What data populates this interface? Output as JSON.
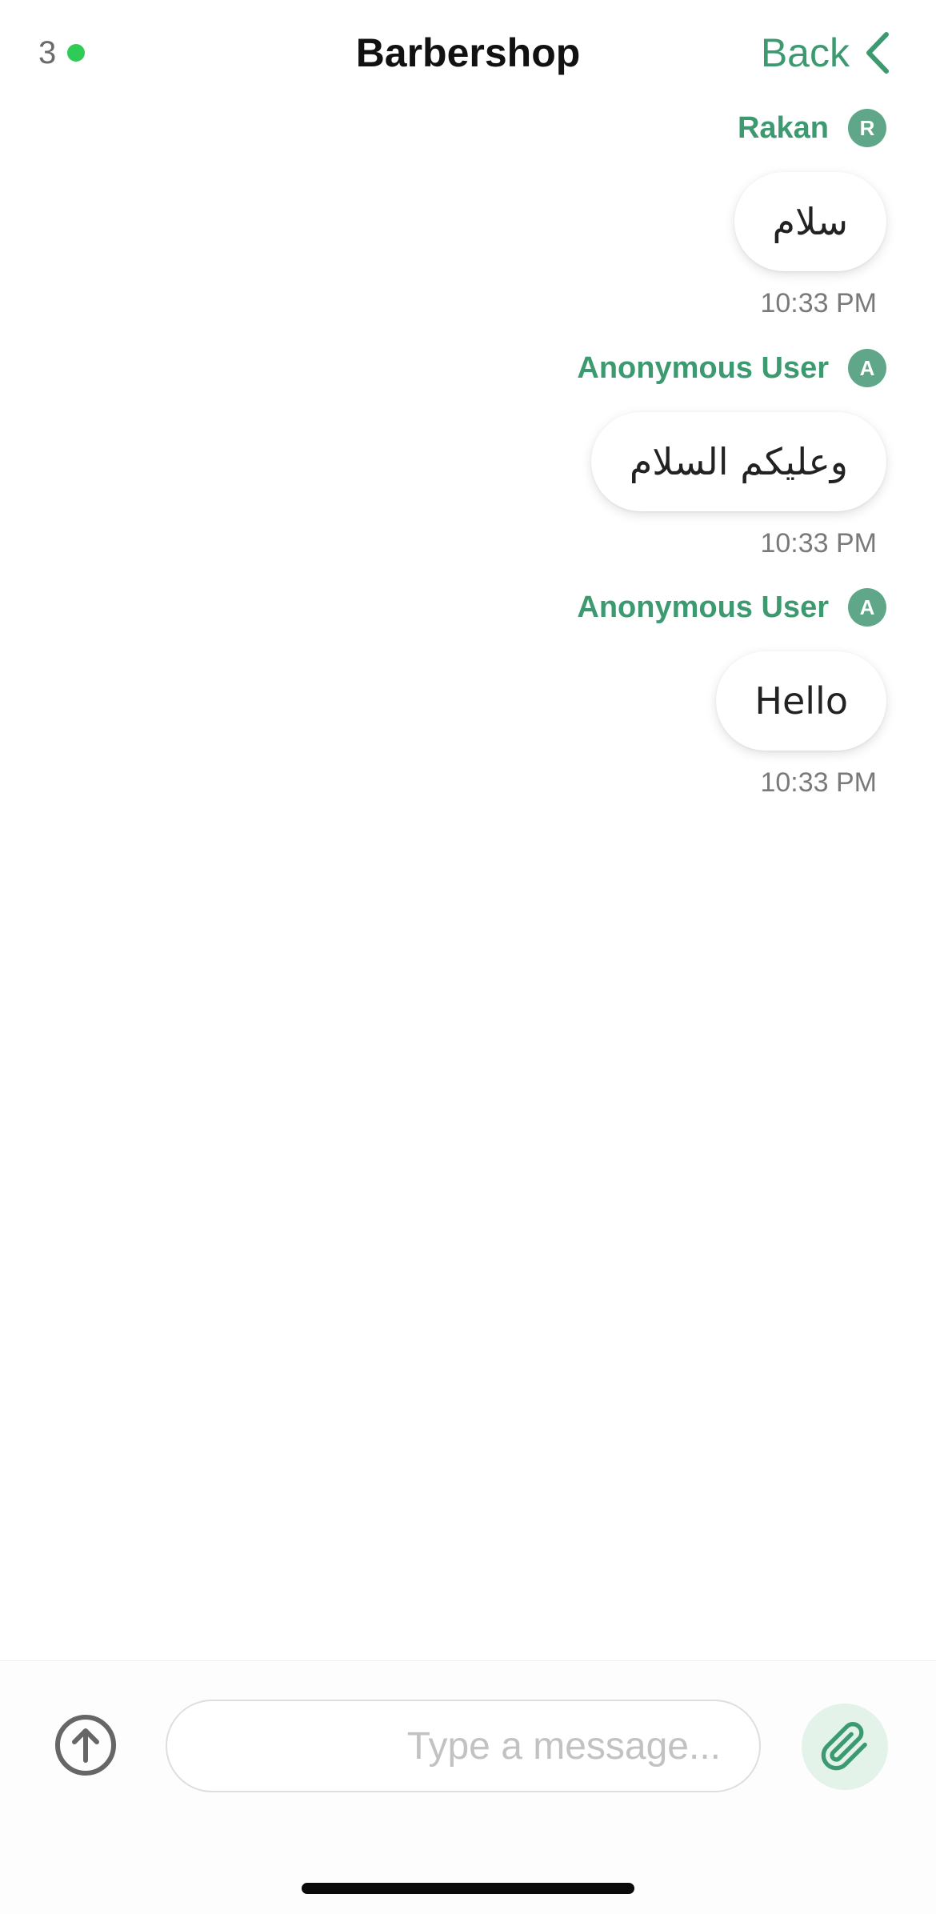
{
  "header": {
    "online_count": "3",
    "title": "Barbershop",
    "back_label": "Back"
  },
  "messages": [
    {
      "sender": "Rakan",
      "avatar_letter": "R",
      "text": "سلام",
      "time": "10:33 PM"
    },
    {
      "sender": "Anonymous User",
      "avatar_letter": "A",
      "text": "وعليكم السلام",
      "time": "10:33 PM"
    },
    {
      "sender": "Anonymous User",
      "avatar_letter": "A",
      "text": "Hello",
      "time": "10:33 PM"
    }
  ],
  "composer": {
    "placeholder": "Type a message...",
    "value": ""
  },
  "icons": {
    "online_indicator": "status-dot",
    "back": "chevron-left-icon",
    "upload": "arrow-up-circle-icon",
    "attach": "paperclip-icon"
  },
  "colors": {
    "accent": "#3d9a70",
    "online": "#2fcb56",
    "avatar": "#5fa788",
    "attach_bg": "#e3f3ea"
  }
}
